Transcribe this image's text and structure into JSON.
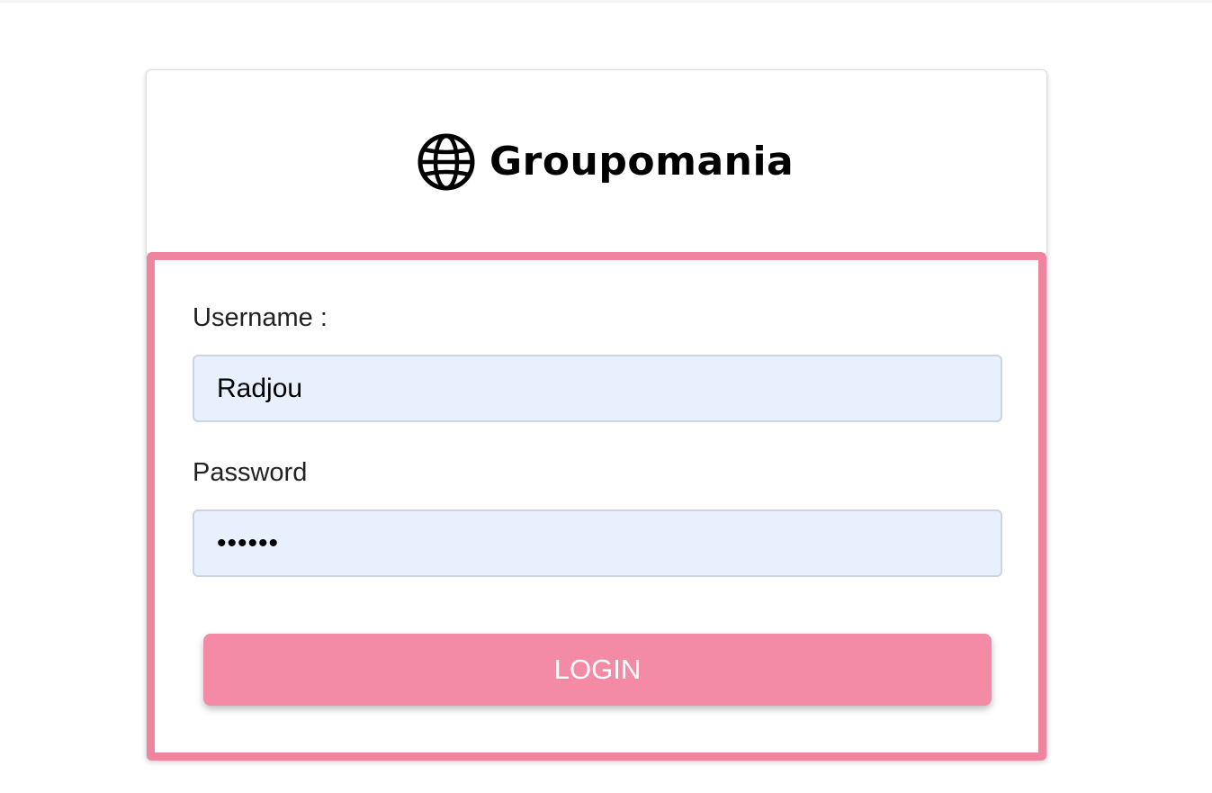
{
  "brand": {
    "name": "Groupomania",
    "logo_icon": "globe-icon"
  },
  "form": {
    "username_label": "Username :",
    "username_value": "Radjou",
    "password_label": "Password",
    "password_value": "••••••",
    "login_label": "LOGIN"
  },
  "colors": {
    "accent_border": "#ef849f",
    "button_bg": "#f38ba5",
    "input_bg": "#e8f0fd"
  }
}
